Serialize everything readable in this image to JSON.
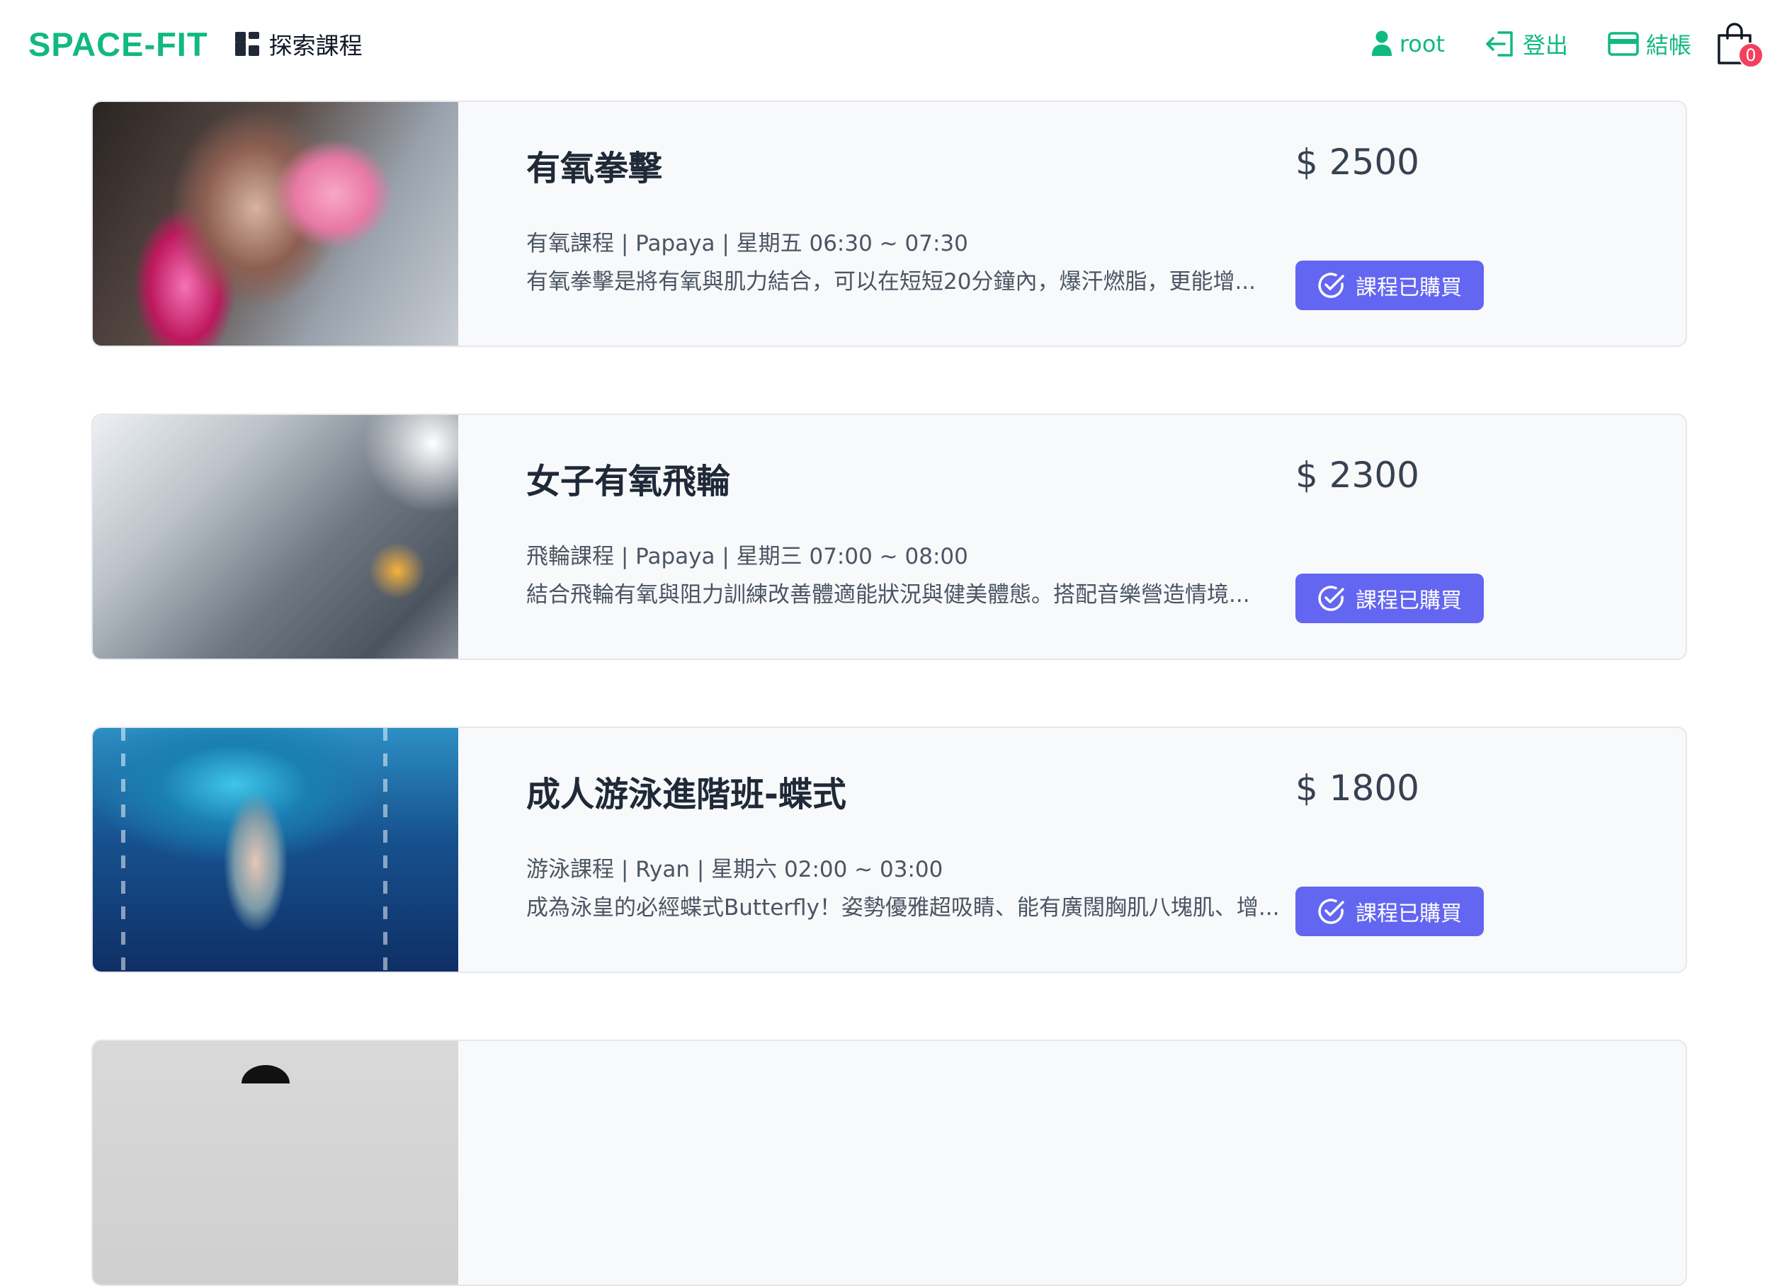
{
  "brand": "SPACE-FIT",
  "nav": {
    "explore_label": "探索課程",
    "user_label": "root",
    "logout_label": "登出",
    "checkout_label": "結帳",
    "cart_count": "0"
  },
  "colors": {
    "brand": "#10b981",
    "button": "#6366f1",
    "badge": "#f43f5e"
  },
  "courses": [
    {
      "title": "有氧拳擊",
      "meta": "有氧課程 | Papaya | 星期五 06:30 ~ 07:30",
      "description": "有氧拳擊是將有氧與肌力結合，可以在短短20分鐘內，爆汗燃脂，更能增...",
      "price": "$ 2500",
      "button_label": "課程已購買",
      "image": "boxing-photo"
    },
    {
      "title": "女子有氧飛輪",
      "meta": "飛輪課程 | Papaya | 星期三 07:00 ~ 08:00",
      "description": "結合飛輪有氧與阻力訓練改善體適能狀況與健美體態。搭配音樂營造情境...",
      "price": "$ 2300",
      "button_label": "課程已購買",
      "image": "spin-bike-photo"
    },
    {
      "title": "成人游泳進階班-蝶式",
      "meta": "游泳課程 | Ryan | 星期六 02:00 ~ 03:00",
      "description": "成為泳皇的必經蝶式Butterfly！姿勢優雅超吸睛、能有廣闊胸肌八塊肌、增...",
      "price": "$ 1800",
      "button_label": "課程已購買",
      "image": "swimming-photo"
    }
  ]
}
